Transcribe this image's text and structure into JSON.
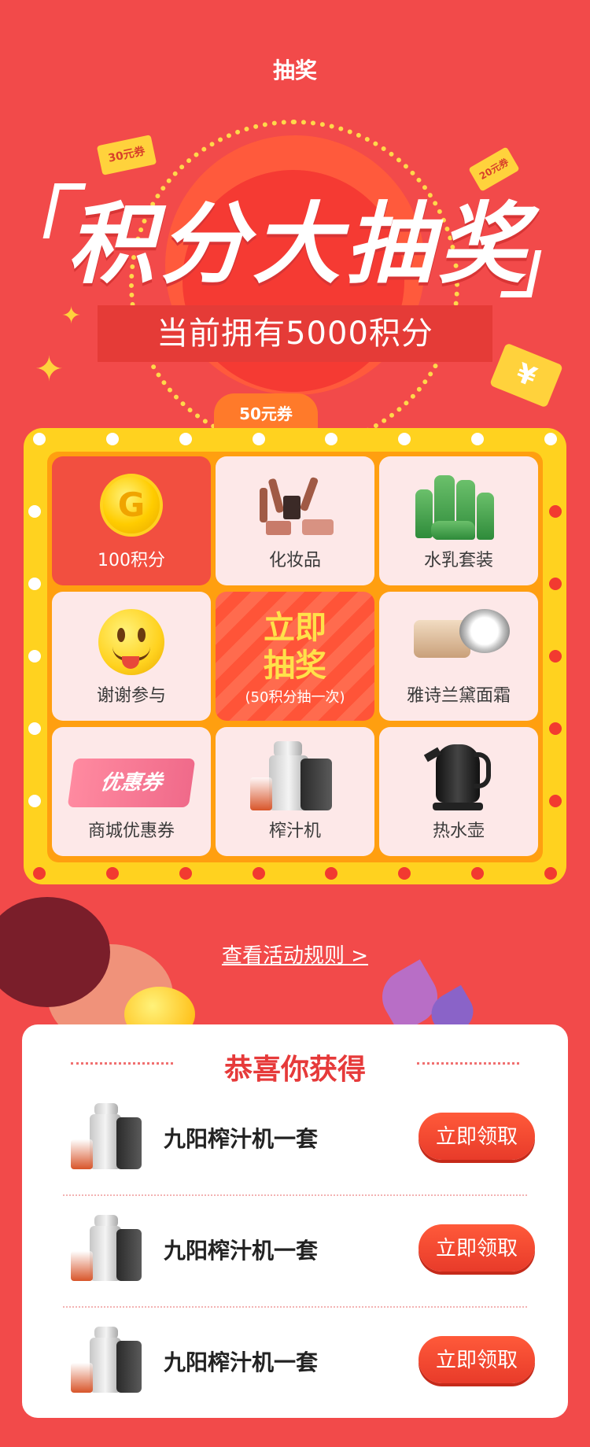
{
  "header": {
    "title": "抽奖"
  },
  "hero": {
    "title": "积分大抽奖",
    "points_text": "当前拥有5000积分",
    "coupon_30": "30元券",
    "coupon_20": "20元券",
    "coupon_50": "50元券",
    "yuan_symbol": "¥"
  },
  "board": {
    "cells": [
      {
        "label": "100积分",
        "icon": "gold-coin-icon",
        "coin_letter": "G",
        "highlighted": true
      },
      {
        "label": "化妆品",
        "icon": "cosmetics-icon"
      },
      {
        "label": "水乳套装",
        "icon": "skincare-set-icon"
      },
      {
        "label": "谢谢参与",
        "icon": "smiley-icon"
      },
      {
        "label": "雅诗兰黛面霜",
        "icon": "face-cream-icon"
      },
      {
        "label": "商城优惠券",
        "icon": "coupon-icon",
        "coupon_text": "优惠券"
      },
      {
        "label": "榨汁机",
        "icon": "juicer-icon"
      },
      {
        "label": "热水壶",
        "icon": "kettle-icon"
      }
    ],
    "draw_button": {
      "title_line1": "立即",
      "title_line2": "抽奖",
      "subtitle": "(50积分抽一次)"
    }
  },
  "rules_link": "查看活动规则 >",
  "results": {
    "title": "恭喜你获得",
    "items": [
      {
        "name": "九阳榨汁机一套",
        "button": "立即领取"
      },
      {
        "name": "九阳榨汁机一套",
        "button": "立即领取"
      },
      {
        "name": "九阳榨汁机一套",
        "button": "立即领取"
      }
    ]
  },
  "colors": {
    "background": "#f24a4a",
    "board_yellow": "#ffd21f",
    "board_orange": "#ff9f10",
    "accent_red": "#e63a3a"
  }
}
